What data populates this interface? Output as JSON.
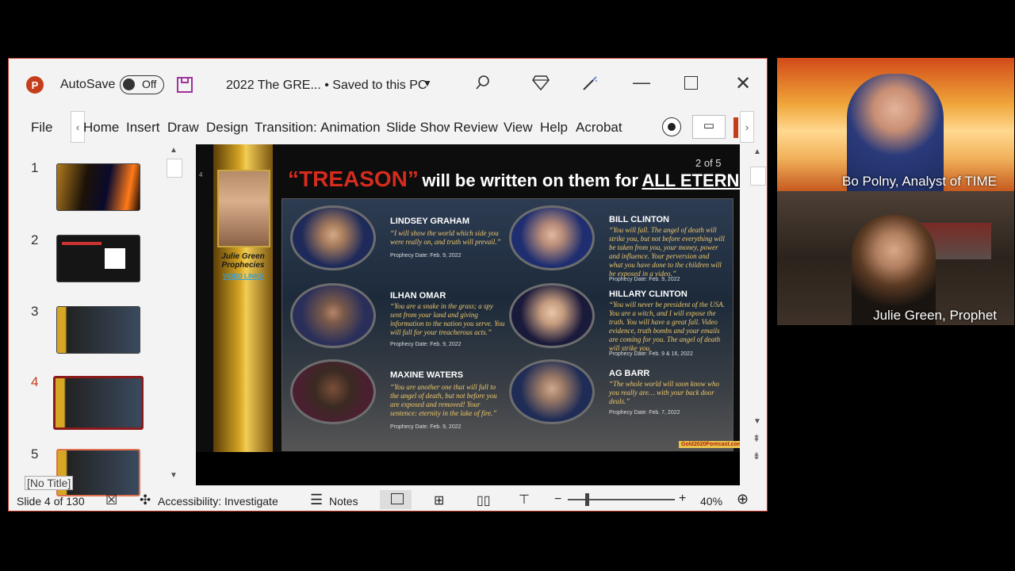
{
  "titlebar": {
    "autosave_label": "AutoSave",
    "toggle_state": "Off",
    "doc_title": "2022 The GRE...",
    "saved_state": "• Saved to this PC"
  },
  "ribbon": {
    "tabs": [
      "File",
      "Home",
      "Insert",
      "Draw",
      "Design",
      "Transition:",
      "Animation",
      "Slide Show",
      "Review",
      "View",
      "Help",
      "Acrobat"
    ]
  },
  "thumbnails": [
    {
      "num": "1"
    },
    {
      "num": "2"
    },
    {
      "num": "3"
    },
    {
      "num": "4"
    },
    {
      "num": "5"
    }
  ],
  "tooltip": "[No Title]",
  "slide": {
    "slide_number": "4",
    "page_label": "2 of 5",
    "headline_red": "“TREASON”",
    "headline_white": "will be written on them for",
    "headline_underlined": "ALL ETERNITY",
    "side_title_line1": "Julie Green",
    "side_title_line2": "Prophecies",
    "side_link": "VIDEO LINKS",
    "watermark": "Gold2020Forecast.com",
    "people": [
      {
        "name": "LINDSEY GRAHAM",
        "quote": "“I will show the world which side you were really on, and truth will prevail.”",
        "date": "Prophecy Date: Feb. 9, 2022"
      },
      {
        "name": "ILHAN OMAR",
        "quote": "“You are a snake in the grass; a spy sent from your land and giving information to the nation you serve. You will fall for your treacherous acts.”",
        "date": "Prophecy Date: Feb. 9, 2022"
      },
      {
        "name": "MAXINE WATERS",
        "quote": "“You are another one that will fall to the angel of death, but not before you are exposed and removed! Your sentence: eternity in the lake of fire.”",
        "date": "Prophecy Date: Feb. 9, 2022"
      },
      {
        "name": "BILL CLINTON",
        "quote": "“You will fall. The angel of death will strike you, but not before everything will be taken from you, your money, power and influence. Your perversion and what you have done to the children will be exposed in a video.”",
        "date": "Prophecy Date: Feb. 9, 2022"
      },
      {
        "name": "HILLARY CLINTON",
        "quote": "“You will never be president of the USA. You are a witch, and I will expose the truth. You will have a great fall. Video evidence, truth bombs and your emails are coming for you. The angel of death will strike you.",
        "date": "Prophecy Date: Feb. 9 & 16, 2022"
      },
      {
        "name": "AG BARR",
        "quote": "“The whole world will soon know who you really are… with your back door deals.”",
        "date": "Prophecy Date: Feb. 7, 2022"
      }
    ]
  },
  "statusbar": {
    "slide_count": "Slide 4 of 130",
    "accessibility": "Accessibility: Investigate",
    "notes": "Notes",
    "zoom": "40%"
  },
  "video": {
    "top_caption": "Bo Polny, Analyst of TIME",
    "bottom_caption": "Julie Green, Prophet"
  },
  "colors": {
    "accent": "#c43e1c",
    "headline_red": "#d62b1e",
    "gold": "#d7a624",
    "quote": "#f0c96b"
  }
}
